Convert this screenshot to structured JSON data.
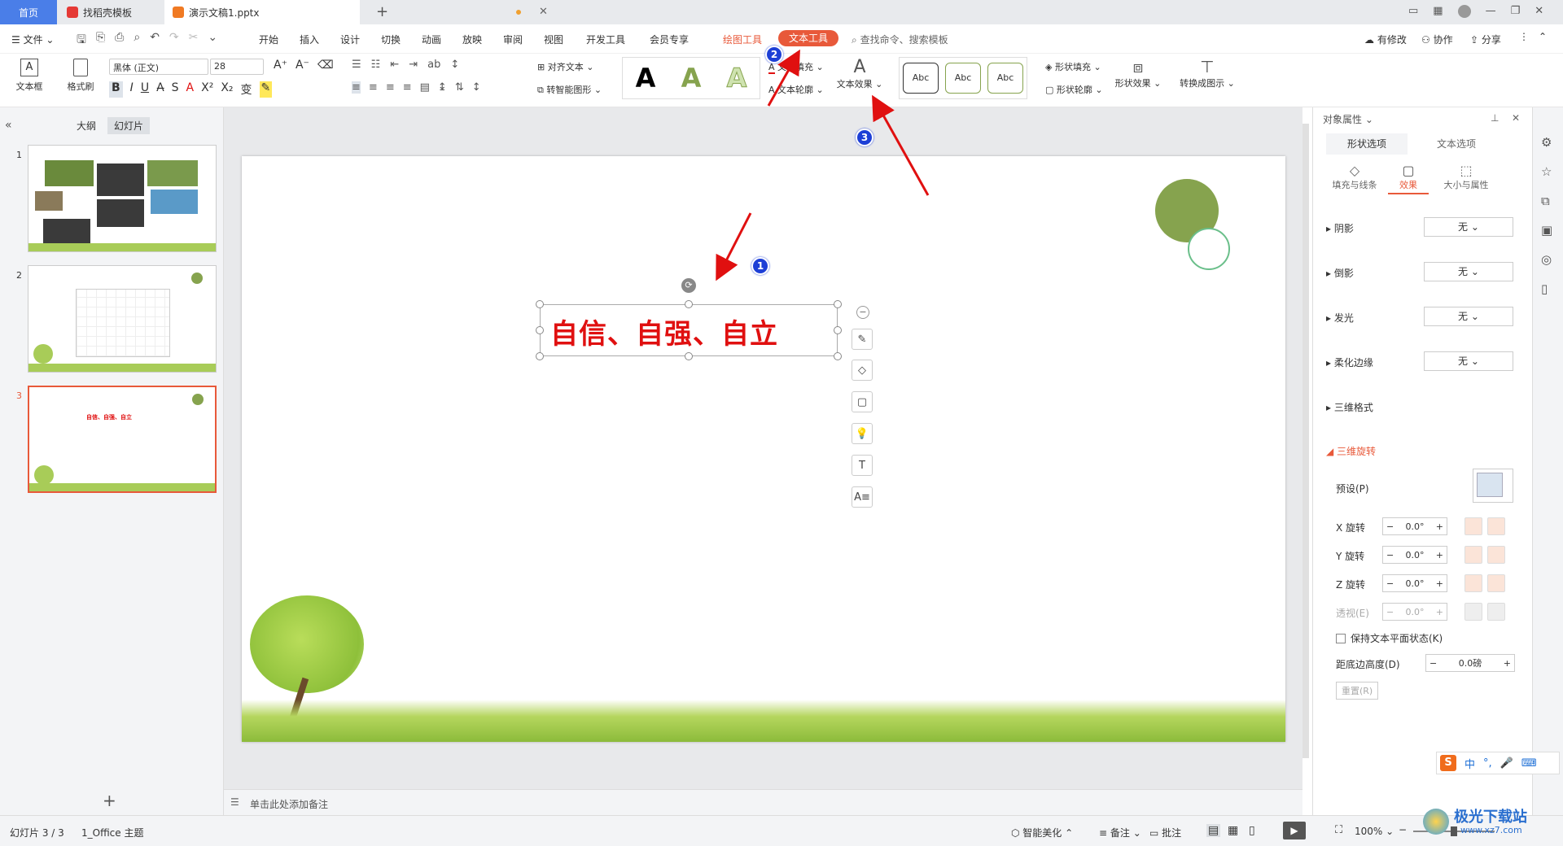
{
  "tabs": {
    "home": "首页",
    "tab1": "找稻壳模板",
    "tab2": "演示文稿1.pptx"
  },
  "menu": {
    "file": "文件",
    "items": [
      "开始",
      "插入",
      "设计",
      "切换",
      "动画",
      "放映",
      "审阅",
      "视图",
      "开发工具",
      "会员专享"
    ],
    "drawing_tools": "绘图工具",
    "text_tools": "文本工具",
    "search": "查找命令、搜索模板",
    "modified": "有修改",
    "collab": "协作",
    "share": "分享"
  },
  "ribbon": {
    "textbox": "文本框",
    "format_painter": "格式刷",
    "font_name": "黑体 (正文)",
    "font_size": "28",
    "align_text": "对齐文本",
    "smart_shape": "转智能图形",
    "text_fill": "文本填充",
    "text_outline": "文本轮廓",
    "text_effects": "文本效果",
    "style_sample": "Abc",
    "shape_fill": "形状填充",
    "shape_outline": "形状轮廓",
    "shape_effects": "形状效果",
    "convert_diagram": "转换成图示"
  },
  "left": {
    "outline": "大纲",
    "slides": "幻灯片",
    "slide_numbers": [
      "1",
      "2",
      "3"
    ],
    "thumb3_title": "自信、自强、自立"
  },
  "slide": {
    "title": "自信、自强、自立"
  },
  "annotations": [
    "1",
    "2",
    "3"
  ],
  "notes": "单击此处添加备注",
  "panel": {
    "title": "对象属性",
    "tab_shape": "形状选项",
    "tab_text": "文本选项",
    "sub_fill": "填充与线条",
    "sub_effects": "效果",
    "sub_size": "大小与属性",
    "shadow": "阴影",
    "reflection": "倒影",
    "glow": "发光",
    "soft_edges": "柔化边缘",
    "format3d": "三维格式",
    "rotation3d": "三维旋转",
    "none": "无",
    "preset": "预设(P)",
    "x_rot": "X 旋转",
    "y_rot": "Y 旋转",
    "z_rot": "Z 旋转",
    "perspective": "透视(E)",
    "rot_value": "0.0°",
    "keep_flat": "保持文本平面状态(K)",
    "distance": "距底边高度(D)",
    "distance_value": "0.0磅",
    "reset": "重置(R)"
  },
  "status": {
    "slide_info": "幻灯片 3 / 3",
    "theme": "1_Office 主题",
    "beautify": "智能美化",
    "notes": "备注",
    "comments": "批注",
    "zoom": "100%"
  },
  "watermark": {
    "name": "极光下载站",
    "url": "www.xz7.com"
  },
  "ime": "中",
  "colors": {
    "accent": "#e8593a",
    "title_red": "#e01010",
    "green": "#86a34e",
    "badge": "#1d3fd6"
  }
}
